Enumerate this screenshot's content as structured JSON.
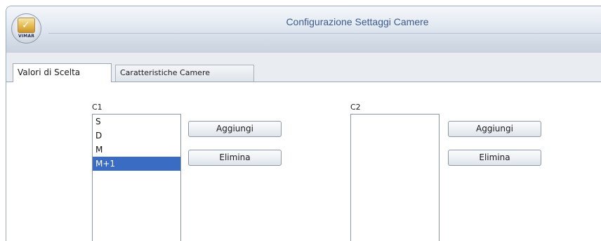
{
  "window": {
    "title": "Configurazione Settaggi Camere",
    "logo_text": "VIMAR"
  },
  "tabs": [
    {
      "label": "Valori di Scelta",
      "active": true
    },
    {
      "label": "Caratteristiche Camere",
      "active": false
    }
  ],
  "columns": [
    {
      "label": "C1",
      "items": [
        "S",
        "D",
        "M",
        "M+1"
      ],
      "selected": "M+1",
      "add_label": "Aggiungi",
      "delete_label": "Elimina"
    },
    {
      "label": "C2",
      "items": [],
      "add_label": "Aggiungi",
      "delete_label": "Elimina"
    }
  ],
  "colors": {
    "selection": "#3b6cc4",
    "title_text": "#3b5a8c"
  },
  "icons": {
    "app_logo": "vimar-logo-icon"
  }
}
